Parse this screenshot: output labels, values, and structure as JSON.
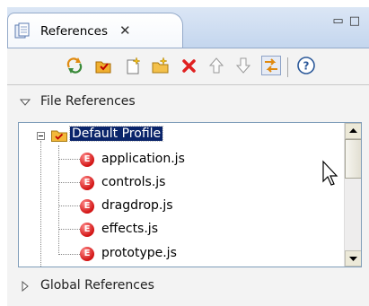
{
  "view": {
    "tab_title": "References",
    "tab_icon": "references-view-icon",
    "close_glyph": "✕",
    "window_controls": [
      "minimize-icon",
      "maximize-icon"
    ]
  },
  "toolbar": {
    "buttons": [
      {
        "name": "refresh-icon"
      },
      {
        "name": "new-profile-icon"
      },
      {
        "name": "add-file-reference-icon"
      },
      {
        "name": "add-folder-icon"
      },
      {
        "name": "delete-icon"
      },
      {
        "name": "move-up-icon"
      },
      {
        "name": "move-down-icon"
      },
      {
        "name": "link-with-editor-icon",
        "pressed": true
      },
      {
        "name": "help-icon"
      }
    ]
  },
  "sections": {
    "file_references": {
      "label": "File References",
      "expanded": true
    },
    "global_references": {
      "label": "Global References",
      "expanded": false
    }
  },
  "tree": {
    "root": {
      "label": "Default Profile",
      "selected": true
    },
    "files": [
      {
        "label": "application.js",
        "badge": "E"
      },
      {
        "label": "controls.js",
        "badge": "E"
      },
      {
        "label": "dragdrop.js",
        "badge": "E"
      },
      {
        "label": "effects.js",
        "badge": "E"
      },
      {
        "label": "prototype.js",
        "badge": "E"
      }
    ]
  },
  "colors": {
    "selection": "#0a246a",
    "badge_red": "#d21414",
    "delete_red": "#e02020",
    "folder_orange": "#f0a020"
  }
}
